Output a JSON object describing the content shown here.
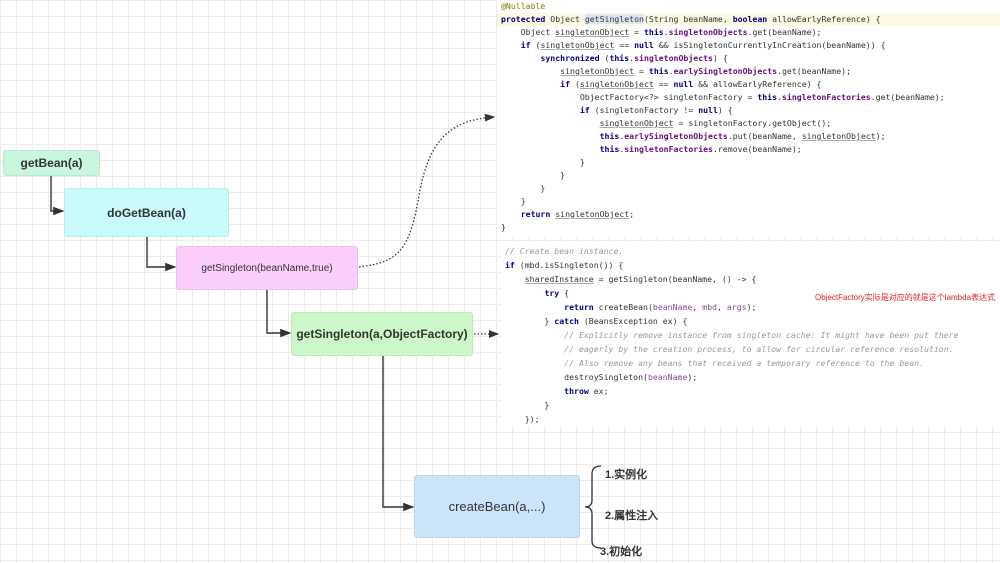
{
  "diagram": {
    "nodes": {
      "get_bean": {
        "label": "getBean(a)",
        "color": "#c8f7dd"
      },
      "do_get_bean": {
        "label": "doGetBean(a)",
        "color": "#c9fafc"
      },
      "get_singleton_early": {
        "label": "getSingleton(beanName,true)",
        "color": "#fbcdfb"
      },
      "get_singleton_factory": {
        "label": "getSingleton(a,ObjectFactory)",
        "color": "#ccf7c8"
      },
      "create_bean": {
        "label": "createBean(a,...)",
        "color": "#cce4fa"
      }
    },
    "steps": [
      "1.实例化",
      "2.属性注入",
      "3.初始化"
    ],
    "annotation": "ObjectFactory实际是对应的就是这个lambda表达式",
    "annotation_color": "#e02020"
  },
  "code_top": [
    [
      [
        "@Nullable",
        "a"
      ]
    ],
    [
      [
        "protected",
        "k"
      ],
      [
        " Object ",
        ""
      ],
      [
        "getSingleton",
        "sel"
      ],
      [
        "(String beanName, ",
        ""
      ],
      [
        "boolean",
        "k"
      ],
      [
        " allowEarlyReference) {",
        ""
      ]
    ],
    [
      [
        "    Object ",
        ""
      ],
      [
        "singletonObject",
        "u"
      ],
      [
        " = ",
        ""
      ],
      [
        "this",
        "k"
      ],
      [
        ".",
        ""
      ],
      [
        "singletonObjects",
        "f"
      ],
      [
        ".get(beanName);",
        ""
      ]
    ],
    [
      [
        "    ",
        ""
      ],
      [
        "if",
        "k"
      ],
      [
        " (",
        ""
      ],
      [
        "singletonObject",
        "u"
      ],
      [
        " == ",
        ""
      ],
      [
        "null",
        "k"
      ],
      [
        " && isSingletonCurrentlyInCreation(beanName)) {",
        ""
      ]
    ],
    [
      [
        "        ",
        ""
      ],
      [
        "synchronized",
        "k"
      ],
      [
        " (",
        ""
      ],
      [
        "this",
        "k"
      ],
      [
        ".",
        ""
      ],
      [
        "singletonObjects",
        "f"
      ],
      [
        ") {",
        ""
      ]
    ],
    [
      [
        "            ",
        ""
      ],
      [
        "singletonObject",
        "u"
      ],
      [
        " = ",
        ""
      ],
      [
        "this",
        "k"
      ],
      [
        ".",
        ""
      ],
      [
        "earlySingletonObjects",
        "f"
      ],
      [
        ".get(beanName);",
        ""
      ]
    ],
    [
      [
        "            ",
        ""
      ],
      [
        "if",
        "k"
      ],
      [
        " (",
        ""
      ],
      [
        "singletonObject",
        "u"
      ],
      [
        " == ",
        ""
      ],
      [
        "null",
        "k"
      ],
      [
        " && allowEarlyReference) {",
        ""
      ]
    ],
    [
      [
        "                ObjectFactory<?> singletonFactory = ",
        ""
      ],
      [
        "this",
        "k"
      ],
      [
        ".",
        ""
      ],
      [
        "singletonFactories",
        "f"
      ],
      [
        ".get(beanName);",
        ""
      ]
    ],
    [
      [
        "                ",
        ""
      ],
      [
        "if",
        "k"
      ],
      [
        " (singletonFactory != ",
        ""
      ],
      [
        "null",
        "k"
      ],
      [
        ") {",
        ""
      ]
    ],
    [
      [
        "                    ",
        ""
      ],
      [
        "singletonObject",
        "u"
      ],
      [
        " = singletonFactory.getObject();",
        ""
      ]
    ],
    [
      [
        "                    ",
        ""
      ],
      [
        "this",
        "k"
      ],
      [
        ".",
        ""
      ],
      [
        "earlySingletonObjects",
        "f"
      ],
      [
        ".put(beanName, ",
        ""
      ],
      [
        "singletonObject",
        "u"
      ],
      [
        ");",
        ""
      ]
    ],
    [
      [
        "                    ",
        ""
      ],
      [
        "this",
        "k"
      ],
      [
        ".",
        ""
      ],
      [
        "singletonFactories",
        "f"
      ],
      [
        ".remove(beanName);",
        ""
      ]
    ],
    [
      [
        "                }",
        ""
      ]
    ],
    [
      [
        "            }",
        ""
      ]
    ],
    [
      [
        "        }",
        ""
      ]
    ],
    [
      [
        "    }",
        ""
      ]
    ],
    [
      [
        "    ",
        ""
      ],
      [
        "return",
        "k"
      ],
      [
        " ",
        ""
      ],
      [
        "singletonObject",
        "u"
      ],
      [
        ";",
        ""
      ]
    ],
    [
      [
        "}",
        ""
      ]
    ]
  ],
  "code_bottom": [
    [
      [
        "// Create bean instance.",
        "c"
      ]
    ],
    [
      [
        "if",
        "k"
      ],
      [
        " (mbd.isSingleton()) {",
        ""
      ]
    ],
    [
      [
        "    ",
        ""
      ],
      [
        "sharedInstance",
        "u"
      ],
      [
        " = getSingleton(beanName, () -> {",
        ""
      ]
    ],
    [
      [
        "        ",
        ""
      ],
      [
        "try",
        "k"
      ],
      [
        " {",
        ""
      ]
    ],
    [
      [
        "            ",
        ""
      ],
      [
        "return",
        "k"
      ],
      [
        " createBean(",
        ""
      ],
      [
        "beanName",
        "p"
      ],
      [
        ", ",
        ""
      ],
      [
        "mbd",
        "p"
      ],
      [
        ", ",
        ""
      ],
      [
        "args",
        "p"
      ],
      [
        ");",
        ""
      ]
    ],
    [
      [
        "        } ",
        ""
      ],
      [
        "catch",
        "k"
      ],
      [
        " (BeansException ex) {",
        ""
      ]
    ],
    [
      [
        "            // Explicitly remove instance from singleton cache: It might have been put there",
        "c"
      ]
    ],
    [
      [
        "            // eagerly by the creation process, to allow for circular reference resolution.",
        "c"
      ]
    ],
    [
      [
        "            // Also remove any beans that received a temporary reference to the bean.",
        "c"
      ]
    ],
    [
      [
        "            destroySingleton(",
        ""
      ],
      [
        "beanName",
        "p"
      ],
      [
        ");",
        ""
      ]
    ],
    [
      [
        "            ",
        ""
      ],
      [
        "throw",
        "k"
      ],
      [
        " ex;",
        ""
      ]
    ],
    [
      [
        "        }",
        ""
      ]
    ],
    [
      [
        "    });",
        ""
      ]
    ]
  ]
}
